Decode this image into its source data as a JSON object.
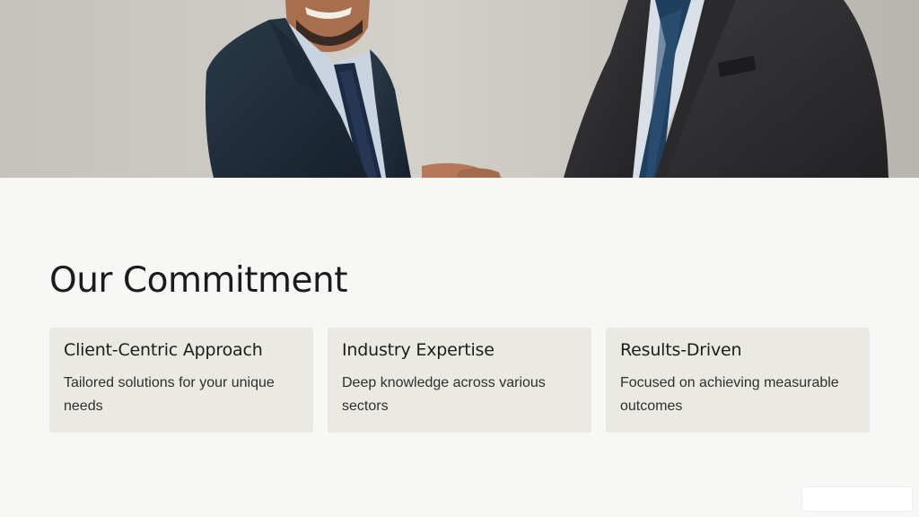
{
  "hero": {
    "image": "business-handshake-photo"
  },
  "section": {
    "title": "Our Commitment",
    "cards": [
      {
        "heading": "Client-Centric Approach",
        "text": "Tailored solutions for your unique needs"
      },
      {
        "heading": "Industry Expertise",
        "text": "Deep knowledge across various sectors"
      },
      {
        "heading": "Results-Driven",
        "text": "Focused on achieving measurable outcomes"
      }
    ]
  },
  "colors": {
    "background": "#f7f7f5",
    "card": "#ebeae2",
    "text": "#1b1b1b"
  }
}
